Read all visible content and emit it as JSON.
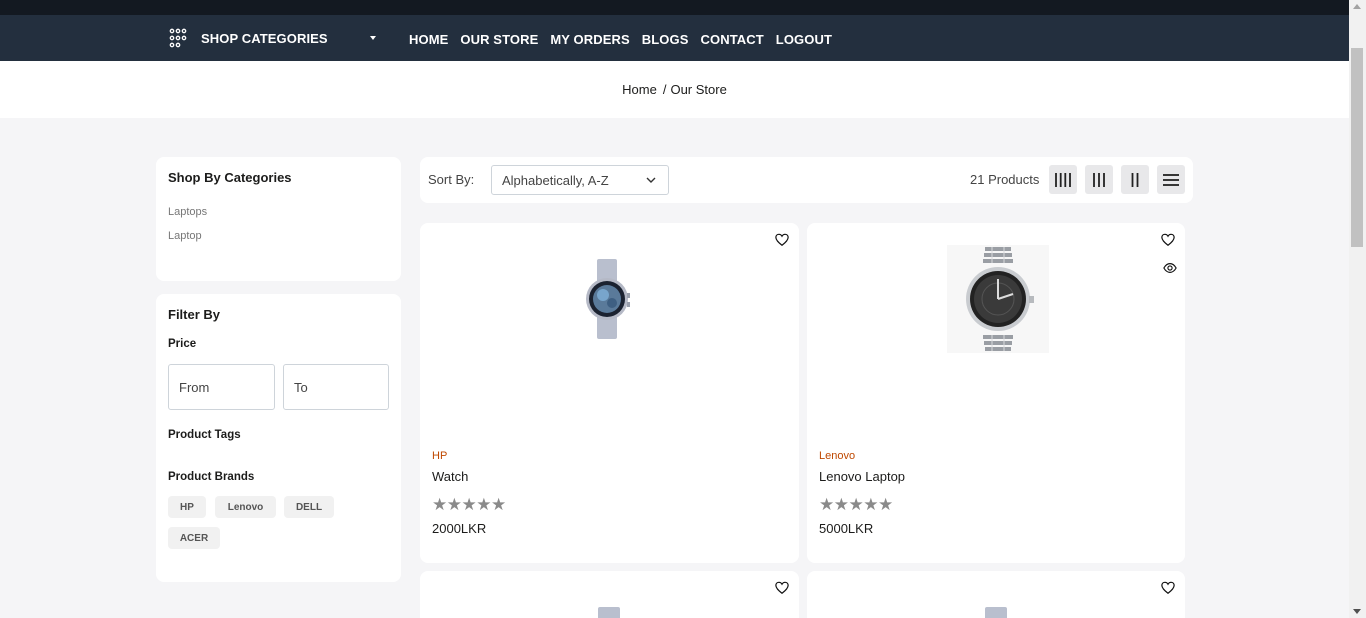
{
  "nav": {
    "categories_label": "SHOP CATEGORIES",
    "menu": [
      "HOME",
      "OUR STORE",
      "MY ORDERS",
      "BLOGS",
      "CONTACT",
      "LOGOUT"
    ]
  },
  "breadcrumb": {
    "home": "Home",
    "separator": "/",
    "current": "Our Store"
  },
  "sidebar": {
    "categories_title": "Shop By Categories",
    "categories": [
      "Laptops",
      "Laptop"
    ],
    "filter_title": "Filter By",
    "price_label": "Price",
    "price_from_placeholder": "From",
    "price_to_placeholder": "To",
    "tags_label": "Product Tags",
    "brands_label": "Product Brands",
    "brands": [
      "HP",
      "Lenovo",
      "DELL",
      "ACER"
    ]
  },
  "sortbar": {
    "sort_label": "Sort By:",
    "sort_value": "Alphabetically, A-Z",
    "count_text": "21 Products"
  },
  "products": [
    {
      "brand": "HP",
      "name": "Watch",
      "stars": "★★★★★",
      "rating": 0,
      "price": "2000LKR"
    },
    {
      "brand": "Lenovo",
      "name": "Lenovo Laptop",
      "stars": "★★★★★",
      "rating": 0,
      "price": "5000LKR"
    }
  ],
  "icons": {
    "categories": "grid-dots-icon",
    "wishlist": "heart-icon",
    "quick_view": "eye-icon",
    "sort": "chevron-down-icon",
    "views": [
      "grid-4-icon",
      "grid-3-icon",
      "grid-2-icon",
      "list-icon"
    ]
  },
  "colors": {
    "nav_bg": "#232f3e",
    "top_strip": "#131921",
    "brand_text": "#bf4800",
    "page_bg": "#f5f5f7"
  }
}
